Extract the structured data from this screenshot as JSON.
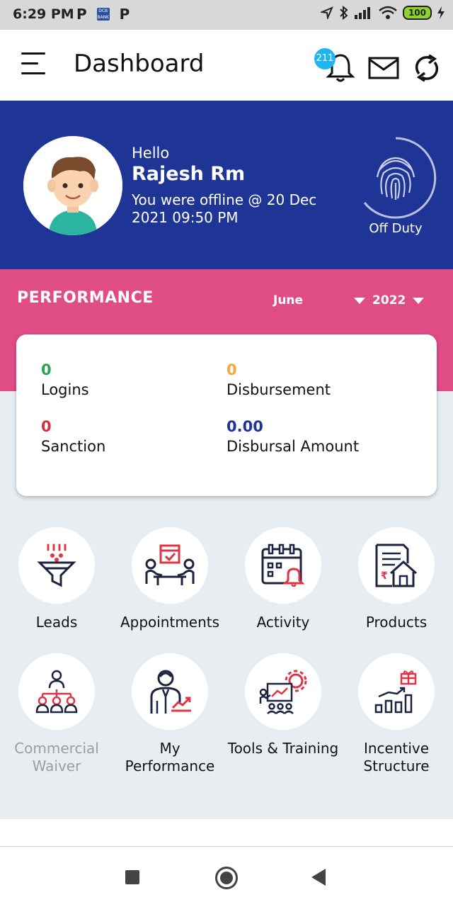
{
  "status_bar": {
    "time": "6:29 PM",
    "left_icons": [
      "P",
      "DCB BANK",
      "P"
    ],
    "battery": "100"
  },
  "header": {
    "title": "Dashboard",
    "notification_count": "211"
  },
  "profile": {
    "greeting": "Hello",
    "name": "Rajesh Rm",
    "last_seen": "You were offline @ 20 Dec 2021 09:50 PM",
    "duty_status": "Off Duty"
  },
  "performance": {
    "title": "PERFORMANCE",
    "month": "June",
    "year": "2022",
    "stats": [
      {
        "value": "0",
        "label": "Logins",
        "color": "#2aa34a"
      },
      {
        "value": "0",
        "label": "Disbursement",
        "color": "#f0a93a"
      },
      {
        "value": "0",
        "label": "Sanction",
        "color": "#d6303f"
      },
      {
        "value": "0.00",
        "label": "Disbursal Amount",
        "color": "#1f3596"
      }
    ]
  },
  "tiles": [
    {
      "label": "Leads",
      "icon": "funnel-icon"
    },
    {
      "label": "Appointments",
      "icon": "meeting-icon"
    },
    {
      "label": "Activity",
      "icon": "calendar-alarm-icon"
    },
    {
      "label": "Products",
      "icon": "document-house-icon"
    },
    {
      "label": "Commercial Waiver",
      "icon": "org-chart-icon"
    },
    {
      "label": "My Performance",
      "icon": "person-growth-icon"
    },
    {
      "label": "Tools & Training",
      "icon": "presentation-gear-icon"
    },
    {
      "label": "Incentive Structure",
      "icon": "bar-chart-gift-icon"
    }
  ],
  "colors": {
    "header_blue": "#1f3596",
    "performance_pink": "#e04d85",
    "icon_red": "#e03444",
    "icon_navy": "#1c2340"
  }
}
